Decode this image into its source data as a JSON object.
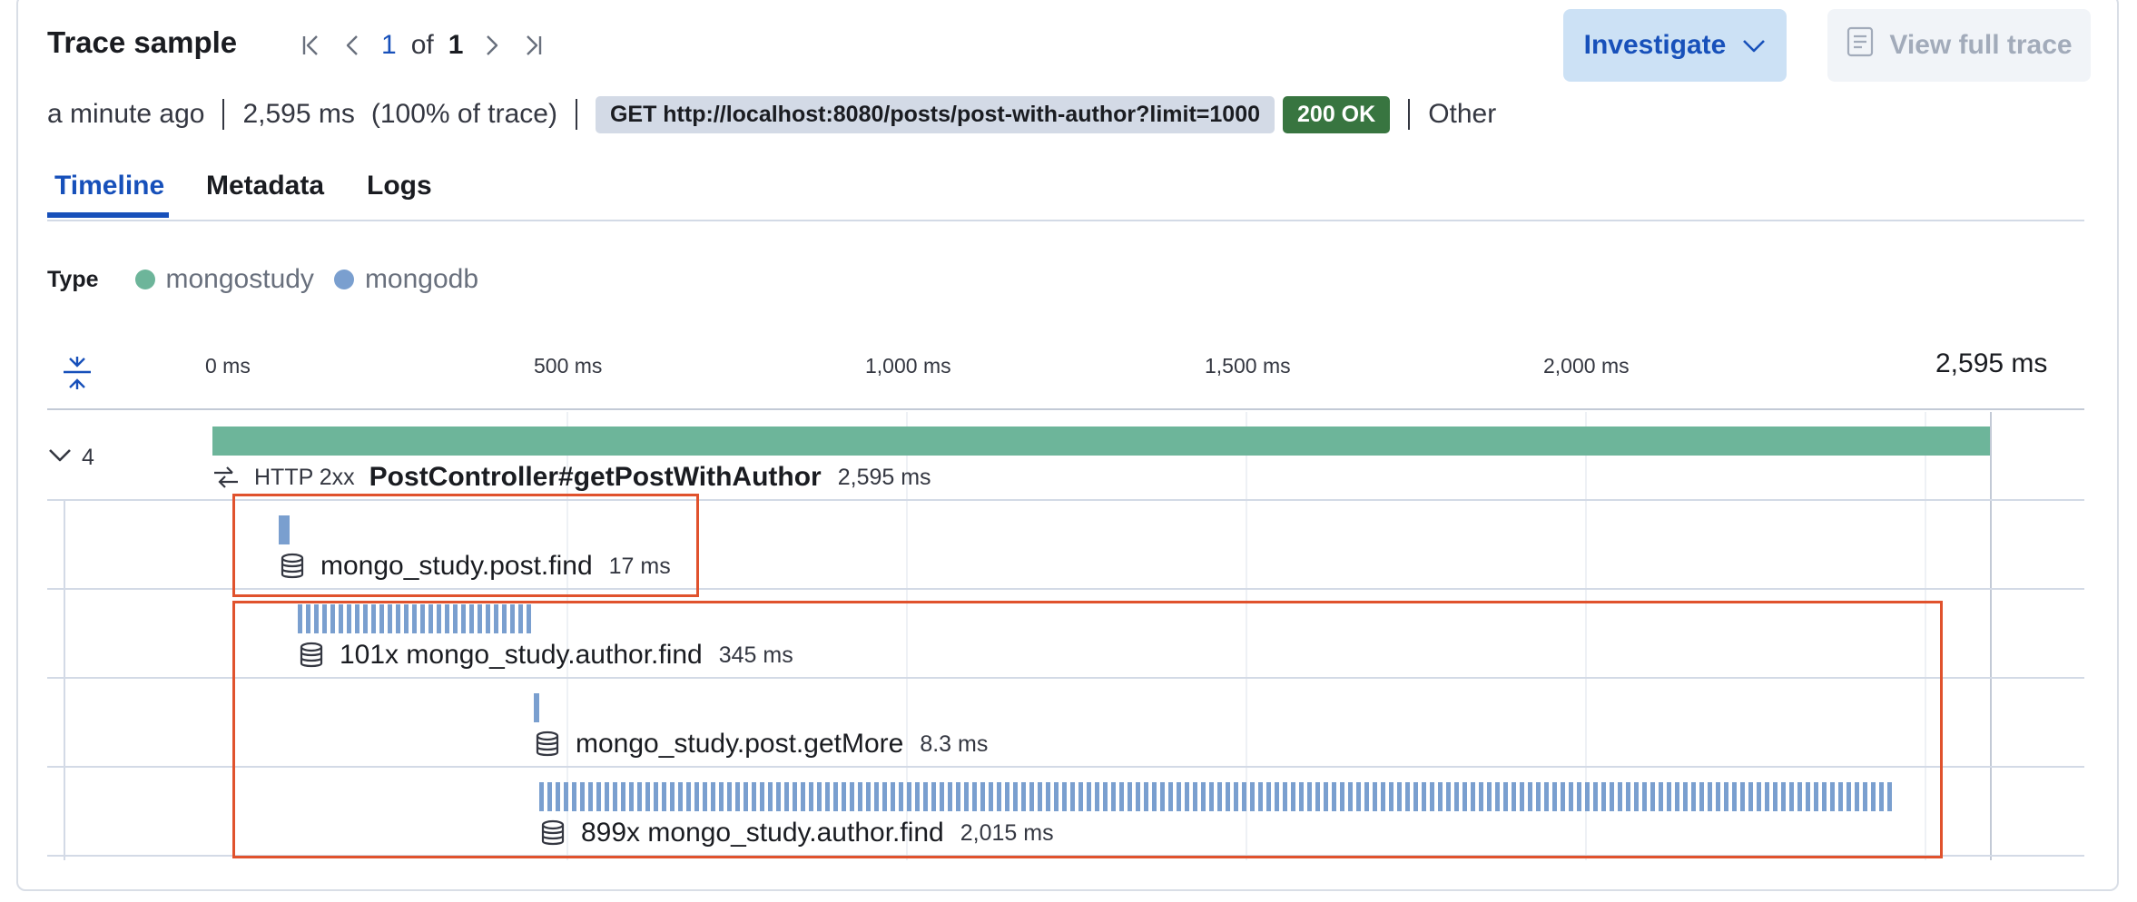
{
  "header": {
    "title": "Trace sample",
    "pager": {
      "current": "1",
      "of": "of",
      "total": "1"
    },
    "investigate_label": "Investigate",
    "view_full_trace_label": "View full trace"
  },
  "summary": {
    "time_ago": "a minute ago",
    "duration": "2,595 ms",
    "percent": "(100% of trace)",
    "request": "GET http://localhost:8080/posts/post-with-author?limit=1000",
    "status": "200 OK",
    "category": "Other"
  },
  "tabs": [
    {
      "label": "Timeline",
      "active": true
    },
    {
      "label": "Metadata",
      "active": false
    },
    {
      "label": "Logs",
      "active": false
    }
  ],
  "legend": {
    "label": "Type",
    "items": [
      {
        "name": "mongostudy",
        "color": "#6db59a"
      },
      {
        "name": "mongodb",
        "color": "#7a9fcf"
      }
    ]
  },
  "timeline": {
    "axis_ticks": [
      "0 ms",
      "500 ms",
      "1,000 ms",
      "1,500 ms",
      "2,000 ms"
    ],
    "axis_end": "2,595 ms",
    "collapse_count": "4",
    "root": {
      "status": "HTTP 2xx",
      "name": "PostController#getPostWithAuthor",
      "duration": "2,595 ms"
    },
    "spans": [
      {
        "name": "mongo_study.post.find",
        "duration": "17 ms"
      },
      {
        "name": "101x mongo_study.author.find",
        "duration": "345 ms"
      },
      {
        "name": "mongo_study.post.getMore",
        "duration": "8.3 ms"
      },
      {
        "name": "899x mongo_study.author.find",
        "duration": "2,015 ms"
      }
    ]
  },
  "colors": {
    "accent": "#1750ba",
    "mongostudy": "#6db59a",
    "mongodb": "#7a9fcf",
    "success": "#387540",
    "highlight": "#e0522d"
  }
}
